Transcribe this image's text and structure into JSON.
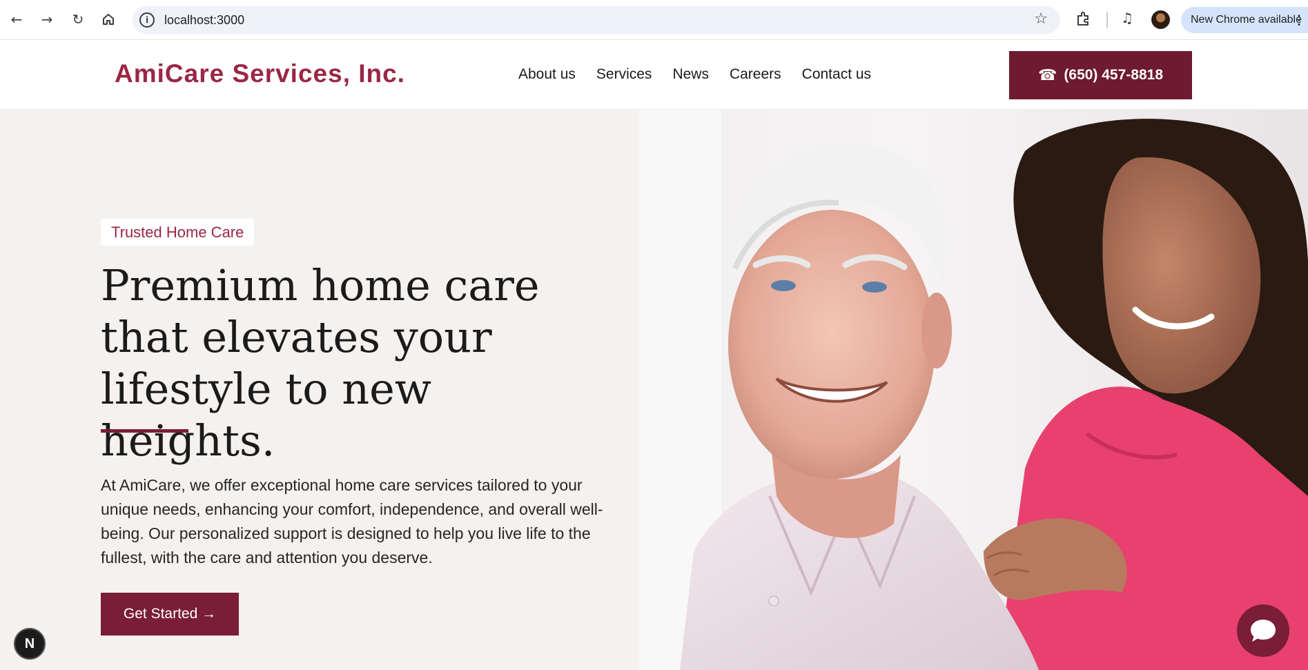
{
  "browser": {
    "url": "localhost:3000",
    "update_label": "New Chrome available"
  },
  "header": {
    "logo": "AmiCare Services, Inc.",
    "nav": [
      "About us",
      "Services",
      "News",
      "Careers",
      "Contact us"
    ],
    "phone": "(650) 457-8818"
  },
  "hero": {
    "tag": "Trusted Home Care",
    "headline": "Premium home care that elevates your lifestyle to new heights.",
    "body": "At AmiCare, we offer exceptional home care services tailored to your unique needs, enhancing your comfort, independence, and overall well-being. Our personalized support is designed to help you live life to the fullest, with the care and attention you deserve.",
    "cta": "Get Started →"
  },
  "devtools_badge": "N",
  "colors": {
    "brand": "#9a2744",
    "brand_dark": "#6e1a30",
    "hero_bg": "#f4f1ef",
    "scrubs": "#e8416f"
  },
  "icons": [
    "back-arrow-icon",
    "forward-arrow-icon",
    "reload-icon",
    "home-icon",
    "site-info-icon",
    "bookmark-star-icon",
    "extensions-icon",
    "media-controls-icon",
    "profile-avatar",
    "more-menu-icon",
    "phone-icon",
    "chat-bubble-icon"
  ]
}
